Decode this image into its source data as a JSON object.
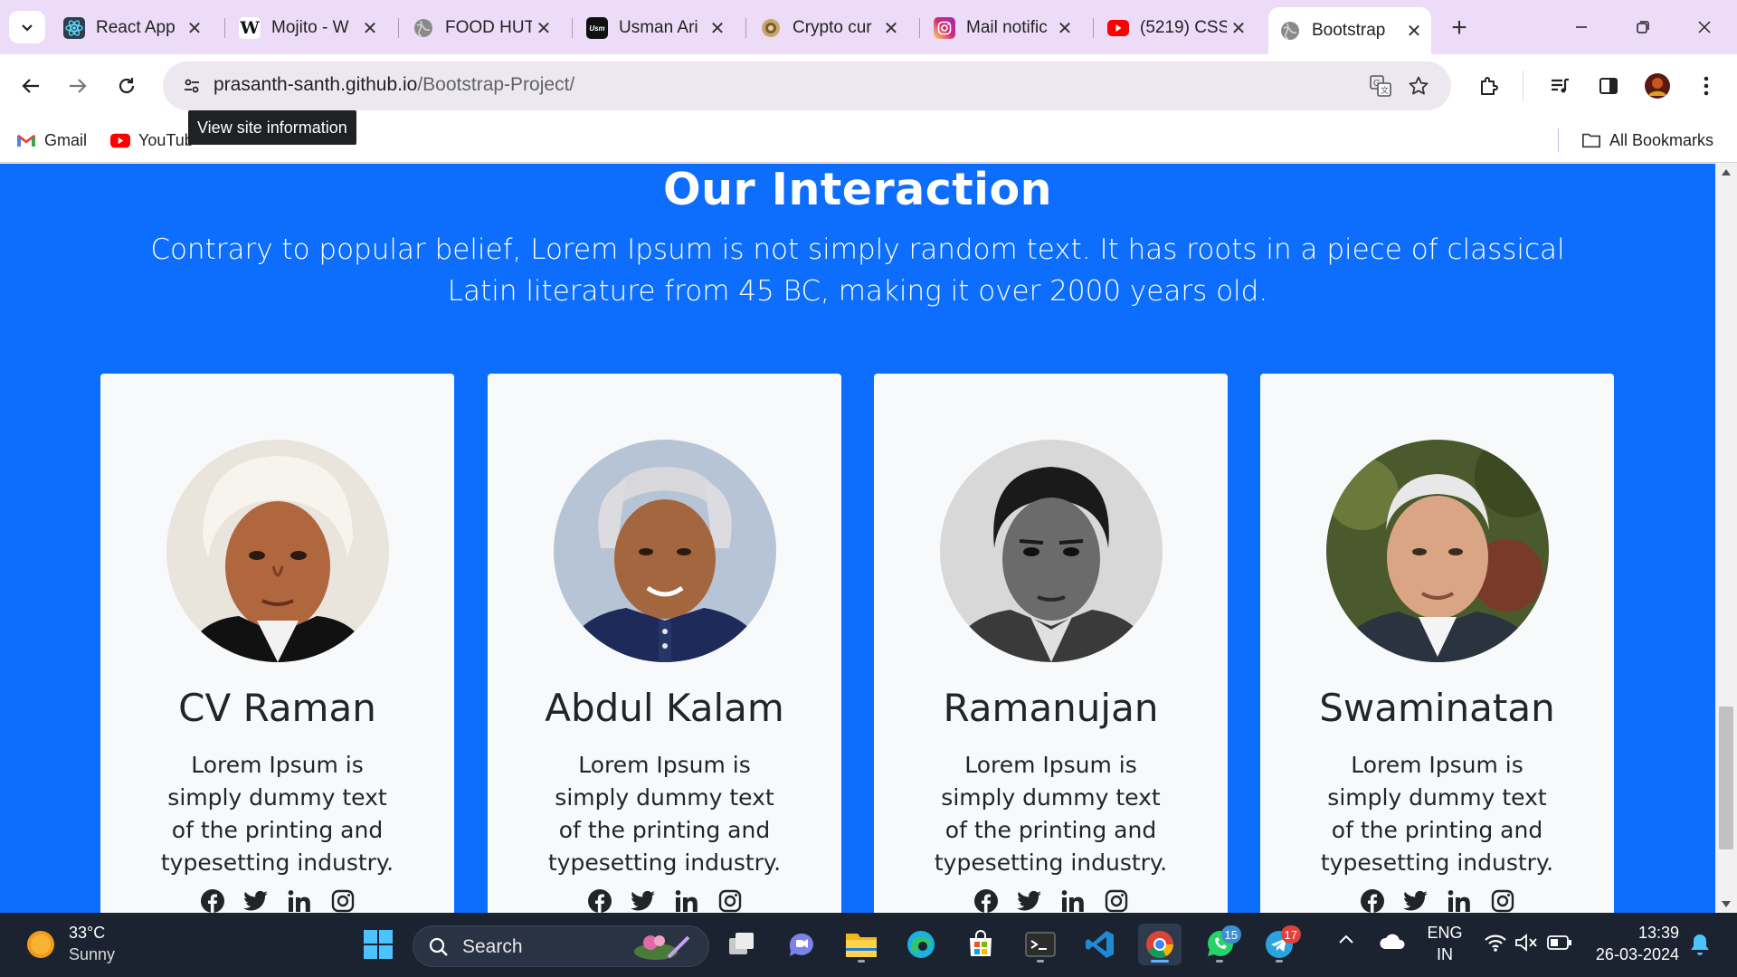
{
  "browser": {
    "tabs": [
      {
        "title": "React App",
        "icon": "react-icon",
        "color": "#2c3e50"
      },
      {
        "title": "Mojito - W",
        "icon": "wikipedia-icon",
        "color": "#ffffff"
      },
      {
        "title": "FOOD HUT",
        "icon": "globe-icon",
        "color": "#8a8a8a"
      },
      {
        "title": "Usman Ari",
        "icon": "usman-logo-icon",
        "color": "#111111"
      },
      {
        "title": "Crypto cur",
        "icon": "crypto-icon",
        "color": "#c9a56b"
      },
      {
        "title": "Mail notific",
        "icon": "instagram-icon",
        "color": "#d6249f"
      },
      {
        "title": "(5219) CSS",
        "icon": "youtube-icon",
        "color": "#ff0000"
      },
      {
        "title": "Bootstrap",
        "icon": "globe-icon",
        "color": "#8a8a8a"
      }
    ],
    "url_host": "prasanth-santh.github.io",
    "url_path": "/Bootstrap-Project/",
    "tooltip": "View site information",
    "bookmarks": [
      {
        "label": "Gmail",
        "icon": "gmail-icon"
      },
      {
        "label": "YouTube",
        "icon": "youtube-icon"
      }
    ],
    "all_bookmarks_label": "All Bookmarks"
  },
  "page": {
    "section_title": "Our Interaction",
    "section_text": "Contrary to popular belief, Lorem Ipsum is not simply random text. It has roots in a piece of classical Latin literature from 45 BC, making it over 2000 years old.",
    "cards": [
      {
        "name": "CV Raman",
        "desc": "Lorem Ipsum is simply dummy text of the printing and typesetting industry.",
        "photo": "portrait-cv-raman"
      },
      {
        "name": "Abdul Kalam",
        "desc": "Lorem Ipsum is simply dummy text of the printing and typesetting industry.",
        "photo": "portrait-abdul-kalam"
      },
      {
        "name": "Ramanujan",
        "desc": "Lorem Ipsum is simply dummy text of the printing and typesetting industry.",
        "photo": "portrait-ramanujan"
      },
      {
        "name": "Swaminatan",
        "desc": "Lorem Ipsum is simply dummy text of the printing and typesetting industry.",
        "photo": "portrait-swaminathan"
      }
    ],
    "social_icons": [
      "facebook-icon",
      "twitter-icon",
      "linkedin-icon",
      "instagram-icon"
    ],
    "background_color": "#0d6efd"
  },
  "taskbar": {
    "weather_temp": "33°C",
    "weather_desc": "Sunny",
    "search_placeholder": "Search",
    "whatsapp_badge": "15",
    "telegram_badge": "17",
    "language_1": "ENG",
    "language_2": "IN",
    "time": "13:39",
    "date": "26-03-2024"
  }
}
